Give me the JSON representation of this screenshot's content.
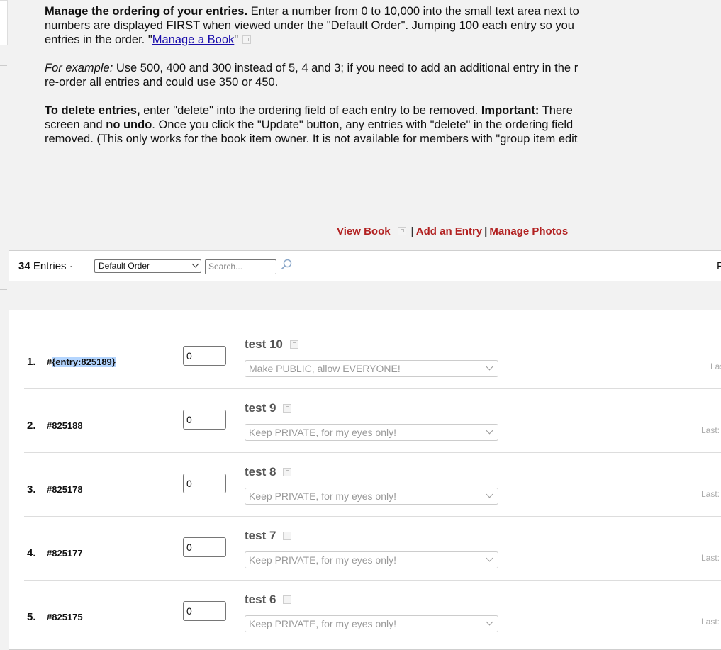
{
  "intro": {
    "p1_bold": "Manage the ordering of your entries.",
    "p1_text": " Enter a number from 0 to 10,000 into the small text area next to",
    "p1_line2": "numbers are displayed FIRST when viewed under the \"Default Order\". Jumping 100 each entry so you",
    "p1_line3_pre": "entries in the order. \"",
    "p1_link": "Manage a Book",
    "p1_line3_post": "\"",
    "p2_em": "For example:",
    "p2_text": " Use 500, 400 and 300 instead of 5, 4 and 3; if you need to add an additional entry in the r",
    "p2_line2": "re-order all entries and could use 350 or 450.",
    "p3_bold1": "To delete entries,",
    "p3_text1": " enter \"delete\" into the ordering field of each entry to be removed. ",
    "p3_bold2": "Important:",
    "p3_text2": " There",
    "p3_line2_pre": "screen and ",
    "p3_line2_bold": "no undo",
    "p3_line2_post": ". Once you click the \"Update\" button, any entries with \"delete\" in the ordering field",
    "p3_line3": "removed. (This only works for the book item owner. It is not available for members with \"group item edit"
  },
  "links": {
    "view_book": "View Book",
    "sep1": "|",
    "add_entry": "Add an Entry",
    "sep2": "|",
    "manage_photos": "Manage Photos"
  },
  "toolbar": {
    "count": "34",
    "count_label": " Entries · ",
    "order_value": "Default Order",
    "search_placeholder": "Search...",
    "right_char": "F"
  },
  "entries": [
    {
      "num": "1.",
      "id_prefix": "#",
      "id": "{entry:825189}",
      "order": "0",
      "title": "test 10",
      "privacy": "Make PUBLIC, allow EVERYONE!",
      "last": "Last"
    },
    {
      "num": "2.",
      "id_prefix": "",
      "id": "#825188",
      "order": "0",
      "title": "test 9",
      "privacy": "Keep PRIVATE, for my eyes only!",
      "last": "Last: F"
    },
    {
      "num": "3.",
      "id_prefix": "",
      "id": "#825178",
      "order": "0",
      "title": "test 8",
      "privacy": "Keep PRIVATE, for my eyes only!",
      "last": "Last: A"
    },
    {
      "num": "4.",
      "id_prefix": "",
      "id": "#825177",
      "order": "0",
      "title": "test 7",
      "privacy": "Keep PRIVATE, for my eyes only!",
      "last": "Last: A"
    },
    {
      "num": "5.",
      "id_prefix": "",
      "id": "#825175",
      "order": "0",
      "title": "test 6",
      "privacy": "Keep PRIVATE, for my eyes only!",
      "last": "Last: A"
    }
  ],
  "colors": {
    "link_red": "#b22222",
    "link_blue": "#1a0dab",
    "highlight": "#b4d5fe"
  }
}
